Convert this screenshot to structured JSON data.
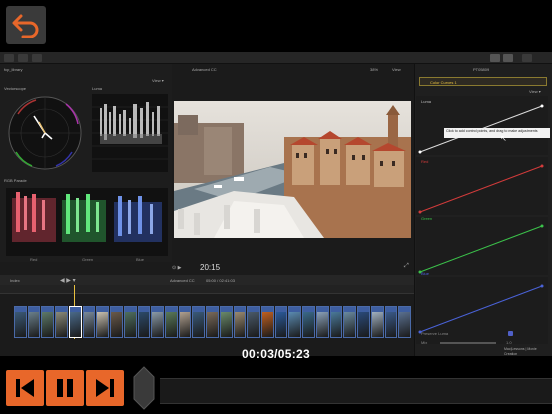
{
  "player": {
    "time": "00:03/05:23",
    "back_icon": "back-arrow-icon",
    "accent": "#e8672a"
  },
  "editor": {
    "library_label": "fcp_library",
    "viewer_title": "Advanced CC",
    "viewer_zoom": "38%",
    "viewer_view": "View",
    "inspector_title": "PT05809",
    "effect_name": "Color Curves 1",
    "vectorscope_label": "Vectorscope",
    "rgb_parade_label": "RGB Parade",
    "luma_label": "Luma",
    "timecode": "20:15",
    "timeline_index": "Index",
    "timeline_project": "Advanced CC",
    "timeline_duration": "05:00 / 02:41:03",
    "curve_tooltip": "Click to add control points, and drag to make adjustments",
    "curve_labels": [
      "Luma",
      "Red",
      "Green",
      "Blue"
    ],
    "preserve_luma": "Preserve Luma",
    "mix_label": "Mix",
    "mix_value": "1.0",
    "parade_channels": [
      "Red",
      "Green",
      "Blue"
    ],
    "watermark": "Mac|Lessons | Movie Creation"
  },
  "colors": {
    "red_curve": "#d23b3b",
    "green_curve": "#3bc24a",
    "blue_curve": "#4a62d8",
    "luma_curve": "#dcdcdc",
    "clip_blue": "#3e5ea0"
  }
}
